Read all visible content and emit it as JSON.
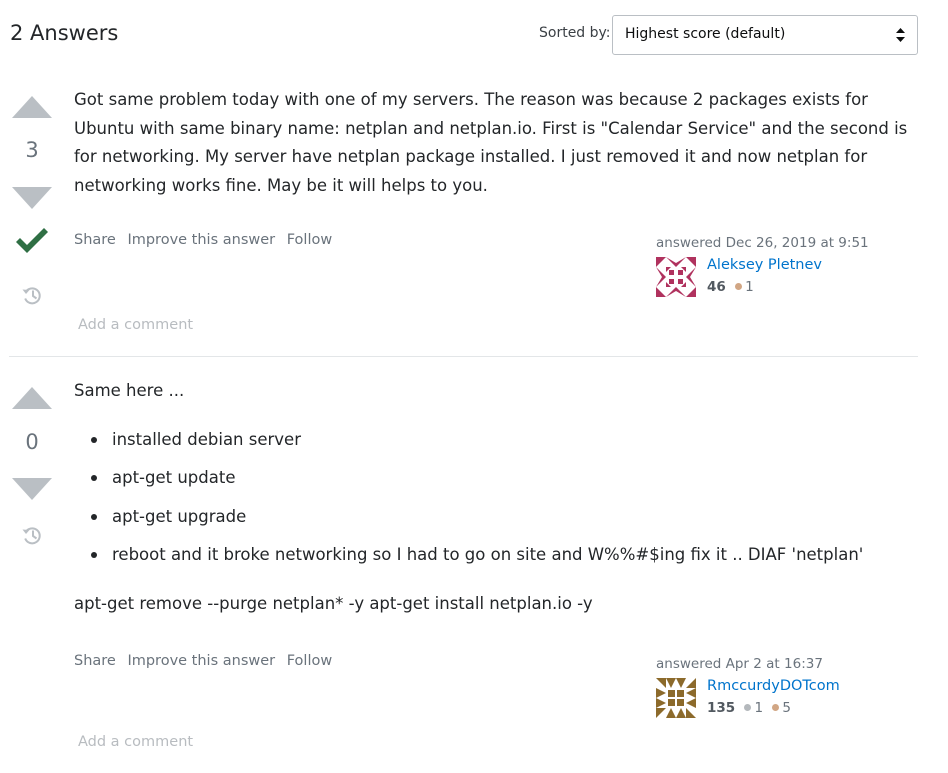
{
  "header": {
    "title": "2 Answers",
    "sort_label": "Sorted by:",
    "sort_value": "Highest score (default)"
  },
  "answers": [
    {
      "score": "3",
      "accepted": true,
      "paragraphs": [
        "Got same problem today with one of my servers. The reason was because 2 packages exists for Ubuntu with same binary name: netplan and netplan.io. First is \"Calendar Service\" and the second is for networking. My server have netplan package installed. I just removed it and now netplan for networking works fine. May be it will helps to you."
      ],
      "menu": {
        "share": "Share",
        "improve": "Improve this answer",
        "follow": "Follow"
      },
      "answered": "answered Dec 26, 2019 at 9:51",
      "user": {
        "name": "Aleksey Pletnev",
        "reputation": "46",
        "bronze": "1"
      },
      "add_comment": "Add a comment"
    },
    {
      "score": "0",
      "accepted": false,
      "intro": "Same here ...",
      "list": [
        "installed debian server",
        "apt-get update",
        "apt-get upgrade",
        "reboot and it broke networking so I had to go on site and W%%#$ing fix it .. DIAF 'netplan'"
      ],
      "outro": "apt-get remove --purge netplan* -y apt-get install netplan.io -y",
      "menu": {
        "share": "Share",
        "improve": "Improve this answer",
        "follow": "Follow"
      },
      "answered": "answered Apr 2 at 16:37",
      "user": {
        "name": "RmccurdyDOTcom",
        "reputation": "135",
        "silver": "1",
        "bronze": "5"
      },
      "add_comment": "Add a comment"
    }
  ],
  "colors": {
    "vote_arrow": "#babfc4",
    "accepted": "#2f6f44",
    "link": "#0074cc",
    "muted": "#6a737c"
  },
  "icons": [
    "sort-arrows-icon",
    "upvote-icon",
    "downvote-icon",
    "accepted-checkmark-icon",
    "history-icon"
  ]
}
